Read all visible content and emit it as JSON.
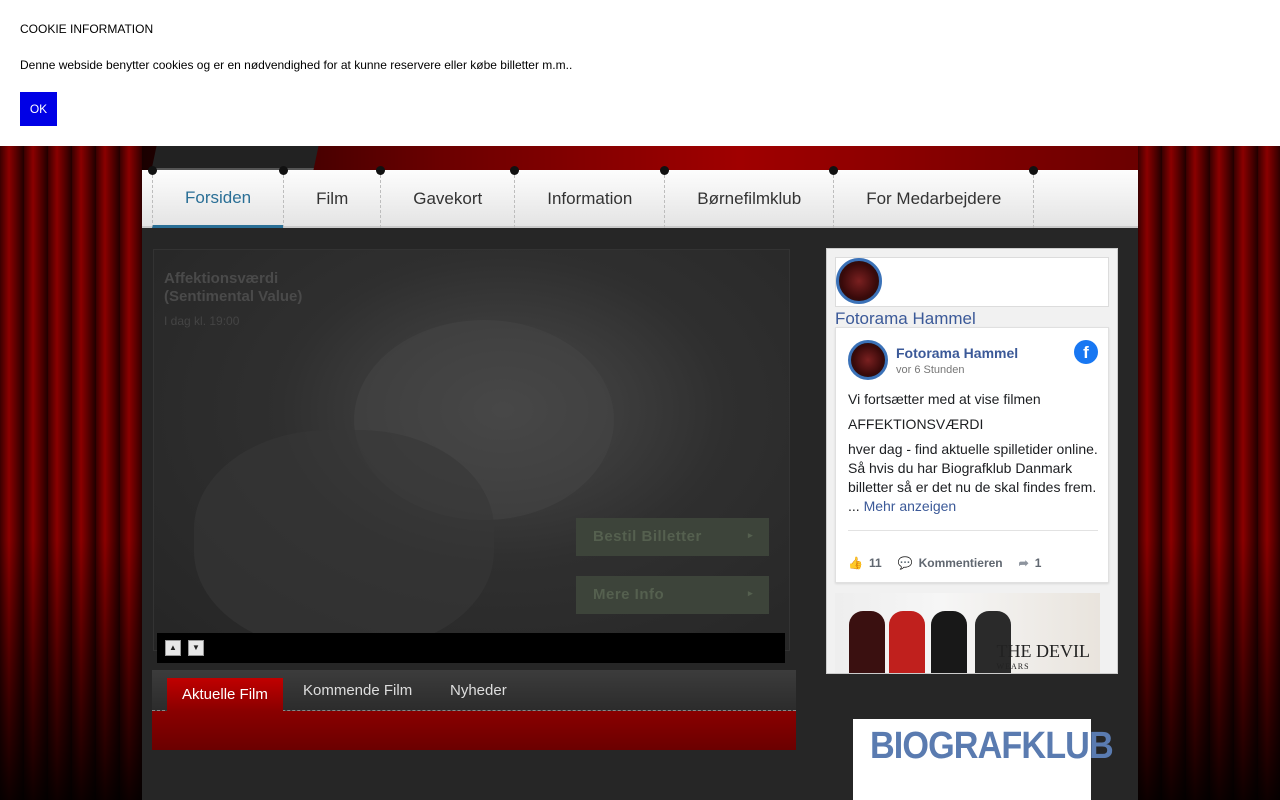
{
  "cookie": {
    "title": "COOKIE INFORMATION",
    "text": "Denne webside benytter cookies og er en nødvendighed for at kunne reservere eller købe billetter m.m..",
    "ok_label": "OK"
  },
  "nav": {
    "items": [
      "Forsiden",
      "Film",
      "Gavekort",
      "Information",
      "Børnefilmklub",
      "For Medarbejdere"
    ],
    "active": "Forsiden"
  },
  "slider": {
    "title_line1": "Affektionsværdi",
    "title_line2": "(Sentimental Value)",
    "date": "I dag kl. 19:00",
    "book_button": "Bestil Billetter",
    "info_button": "Mere Info"
  },
  "tabs": [
    "Aktuelle Film",
    "Kommende Film",
    "Nyheder"
  ],
  "facebook": {
    "page_name": "Fotorama Hammel",
    "post": {
      "author": "Fotorama Hammel",
      "time": "vor 6 Stunden",
      "line1": "Vi fortsætter med at vise filmen",
      "line2": "AFFEKTIONSVÆRDI",
      "line3": "hver dag - find aktuelle spilletider online. Så hvis du har Biografklub Danmark billetter så er det nu de skal findes frem.",
      "ellipsis": "...",
      "more": "Mehr anzeigen",
      "likes": "11",
      "comment_label": "Kommentieren",
      "shares": "1"
    },
    "movie_image_text": "THE DEVIL",
    "movie_image_sub": "WEARS"
  },
  "biografklub": {
    "logo_text": "BIOGRAFKLUB"
  },
  "colors": {
    "accent": "#2a6f96",
    "tab_red": "#c00000",
    "facebook_blue": "#3b5998",
    "cookie_button": "#0000e6"
  }
}
